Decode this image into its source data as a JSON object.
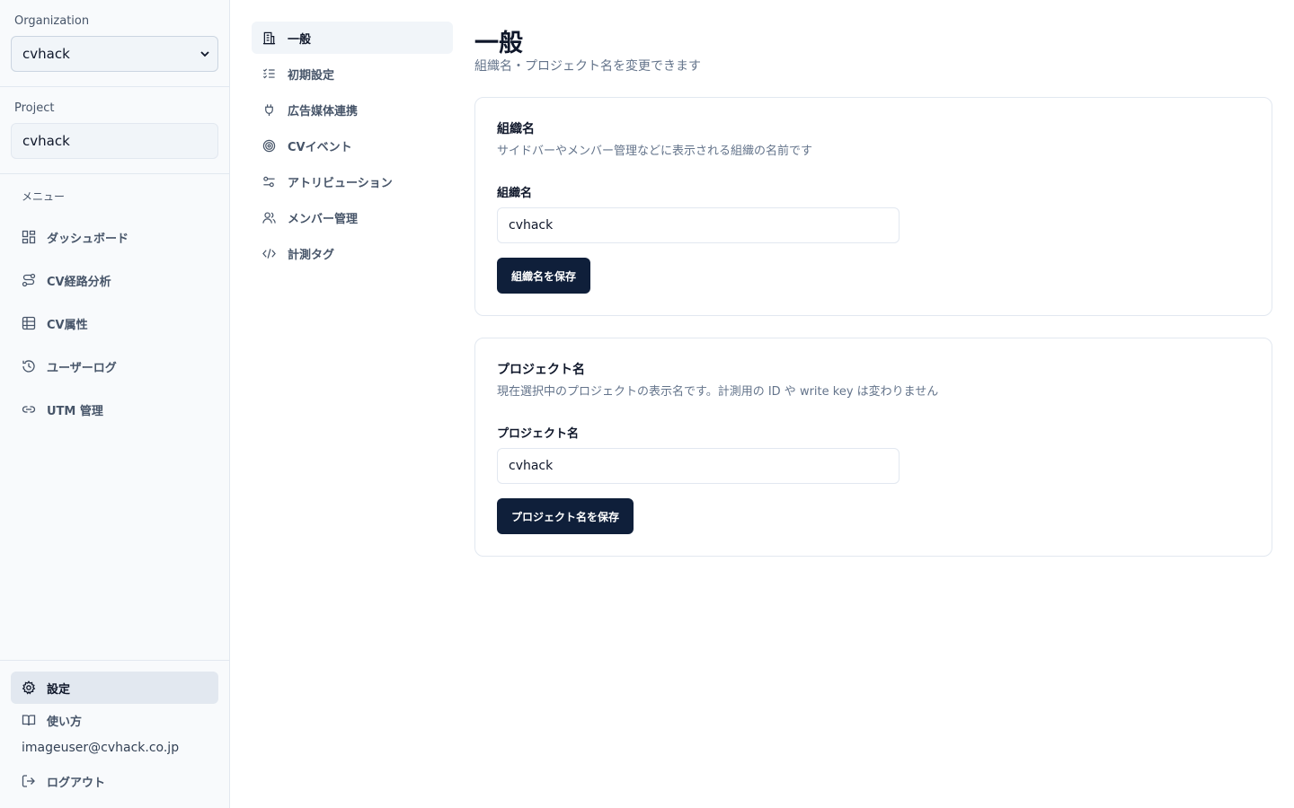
{
  "sidebar": {
    "org_label": "Organization",
    "org_value": "cvhack",
    "project_label": "Project",
    "project_value": "cvhack",
    "menu_heading": "メニュー",
    "items": [
      {
        "label": "ダッシュボード",
        "icon": "dashboard-icon"
      },
      {
        "label": "CV経路分析",
        "icon": "route-icon"
      },
      {
        "label": "CV属性",
        "icon": "table-icon"
      },
      {
        "label": "ユーザーログ",
        "icon": "history-icon"
      },
      {
        "label": "UTM 管理",
        "icon": "link-icon"
      }
    ],
    "footer": {
      "settings": "設定",
      "guide": "使い方",
      "email": "imageuser@cvhack.co.jp",
      "logout": "ログアウト"
    }
  },
  "settings_nav": [
    {
      "label": "一般",
      "icon": "building-icon",
      "active": true
    },
    {
      "label": "初期設定",
      "icon": "checklist-icon"
    },
    {
      "label": "広告媒体連携",
      "icon": "plug-icon"
    },
    {
      "label": "CVイベント",
      "icon": "target-icon"
    },
    {
      "label": "アトリビューション",
      "icon": "sliders-icon"
    },
    {
      "label": "メンバー管理",
      "icon": "users-icon"
    },
    {
      "label": "計測タグ",
      "icon": "code-icon"
    }
  ],
  "main": {
    "title": "一般",
    "subtitle": "組織名・プロジェクト名を変更できます",
    "org_card": {
      "title": "組織名",
      "description": "サイドバーやメンバー管理などに表示される組織の名前です",
      "field_label": "組織名",
      "value": "cvhack",
      "button": "組織名を保存"
    },
    "project_card": {
      "title": "プロジェクト名",
      "description": "現在選択中のプロジェクトの表示名です。計測用の ID や write key は変わりません",
      "field_label": "プロジェクト名",
      "value": "cvhack",
      "button": "プロジェクト名を保存"
    }
  },
  "colors": {
    "primary_button": "#0f1f3a",
    "sidebar_bg": "#f8fafc",
    "border": "#e2e8f0",
    "muted_text": "#64748b"
  }
}
